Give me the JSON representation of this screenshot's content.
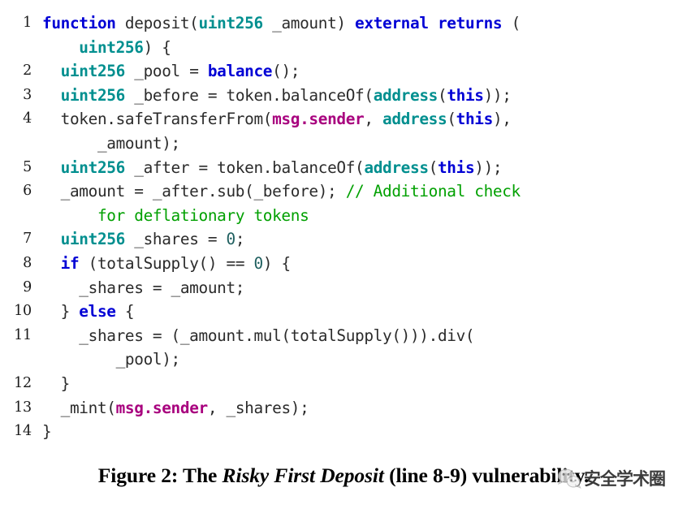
{
  "figure": {
    "type": "code-listing",
    "language": "solidity",
    "caption_prefix": "Figure 2: The ",
    "caption_emphasis": "Risky First Deposit",
    "caption_suffix": " (line 8-9) vulnerability.",
    "caption_full": "Figure 2: The Risky First Deposit (line 8-9) vulnerability."
  },
  "colors": {
    "background": "#ffffff",
    "keyword": "#0000d5",
    "type": "#008f8f",
    "builtin": "#a8017e",
    "comment": "#00a000",
    "plain": "#2b2b2b",
    "line_number": "#1a1a1a",
    "caption": "#000000"
  },
  "code": {
    "lines": [
      {
        "number": "1",
        "tokens": [
          {
            "t": "function",
            "c": "kw"
          },
          {
            "t": " deposit(",
            "c": "plain"
          },
          {
            "t": "uint256",
            "c": "type"
          },
          {
            "t": " _amount) ",
            "c": "plain"
          },
          {
            "t": "external",
            "c": "kw"
          },
          {
            "t": " ",
            "c": "plain"
          },
          {
            "t": "returns",
            "c": "kw"
          },
          {
            "t": " (",
            "c": "plain"
          }
        ]
      },
      {
        "number": "",
        "tokens": [
          {
            "t": "    ",
            "c": "plain"
          },
          {
            "t": "uint256",
            "c": "type"
          },
          {
            "t": ") {",
            "c": "plain"
          }
        ]
      },
      {
        "number": "2",
        "tokens": [
          {
            "t": "  ",
            "c": "plain"
          },
          {
            "t": "uint256",
            "c": "type"
          },
          {
            "t": " _pool = ",
            "c": "plain"
          },
          {
            "t": "balance",
            "c": "fn"
          },
          {
            "t": "();",
            "c": "plain"
          }
        ]
      },
      {
        "number": "3",
        "tokens": [
          {
            "t": "  ",
            "c": "plain"
          },
          {
            "t": "uint256",
            "c": "type"
          },
          {
            "t": " _before = token.balanceOf(",
            "c": "plain"
          },
          {
            "t": "address",
            "c": "type"
          },
          {
            "t": "(",
            "c": "plain"
          },
          {
            "t": "this",
            "c": "kw"
          },
          {
            "t": "));",
            "c": "plain"
          }
        ]
      },
      {
        "number": "4",
        "tokens": [
          {
            "t": "  token.safeTransferFrom(",
            "c": "plain"
          },
          {
            "t": "msg",
            "c": "builtin"
          },
          {
            "t": ".",
            "c": "builtin"
          },
          {
            "t": "sender",
            "c": "builtin"
          },
          {
            "t": ", ",
            "c": "plain"
          },
          {
            "t": "address",
            "c": "type"
          },
          {
            "t": "(",
            "c": "plain"
          },
          {
            "t": "this",
            "c": "kw"
          },
          {
            "t": "),",
            "c": "plain"
          }
        ]
      },
      {
        "number": "",
        "tokens": [
          {
            "t": "      _amount);",
            "c": "plain"
          }
        ]
      },
      {
        "number": "5",
        "tokens": [
          {
            "t": "  ",
            "c": "plain"
          },
          {
            "t": "uint256",
            "c": "type"
          },
          {
            "t": " _after = token.balanceOf(",
            "c": "plain"
          },
          {
            "t": "address",
            "c": "type"
          },
          {
            "t": "(",
            "c": "plain"
          },
          {
            "t": "this",
            "c": "kw"
          },
          {
            "t": "));",
            "c": "plain"
          }
        ]
      },
      {
        "number": "6",
        "tokens": [
          {
            "t": "  _amount = _after.sub(_before); ",
            "c": "plain"
          },
          {
            "t": "// Additional check",
            "c": "comment"
          }
        ]
      },
      {
        "number": "",
        "tokens": [
          {
            "t": "      ",
            "c": "plain"
          },
          {
            "t": "for deflationary tokens",
            "c": "comment"
          }
        ]
      },
      {
        "number": "7",
        "tokens": [
          {
            "t": "  ",
            "c": "plain"
          },
          {
            "t": "uint256",
            "c": "type"
          },
          {
            "t": " _shares = ",
            "c": "plain"
          },
          {
            "t": "0",
            "c": "num"
          },
          {
            "t": ";",
            "c": "plain"
          }
        ]
      },
      {
        "number": "8",
        "tokens": [
          {
            "t": "  ",
            "c": "plain"
          },
          {
            "t": "if",
            "c": "kw"
          },
          {
            "t": " (totalSupply() == ",
            "c": "plain"
          },
          {
            "t": "0",
            "c": "num"
          },
          {
            "t": ") {",
            "c": "plain"
          }
        ]
      },
      {
        "number": "9",
        "tokens": [
          {
            "t": "    _shares = _amount;",
            "c": "plain"
          }
        ]
      },
      {
        "number": "10",
        "tokens": [
          {
            "t": "  } ",
            "c": "plain"
          },
          {
            "t": "else",
            "c": "kw"
          },
          {
            "t": " {",
            "c": "plain"
          }
        ]
      },
      {
        "number": "11",
        "tokens": [
          {
            "t": "    _shares = (_amount.mul(totalSupply())).div(",
            "c": "plain"
          }
        ]
      },
      {
        "number": "",
        "tokens": [
          {
            "t": "        _pool);",
            "c": "plain"
          }
        ]
      },
      {
        "number": "12",
        "tokens": [
          {
            "t": "  }",
            "c": "plain"
          }
        ]
      },
      {
        "number": "13",
        "tokens": [
          {
            "t": "  _mint(",
            "c": "plain"
          },
          {
            "t": "msg",
            "c": "builtin"
          },
          {
            "t": ".",
            "c": "builtin"
          },
          {
            "t": "sender",
            "c": "builtin"
          },
          {
            "t": ", _shares);",
            "c": "plain"
          }
        ]
      },
      {
        "number": "14",
        "tokens": [
          {
            "t": "}",
            "c": "plain"
          }
        ]
      }
    ]
  },
  "watermark": {
    "text": "安全学术圈",
    "logo": "wechat-logo-icon"
  }
}
